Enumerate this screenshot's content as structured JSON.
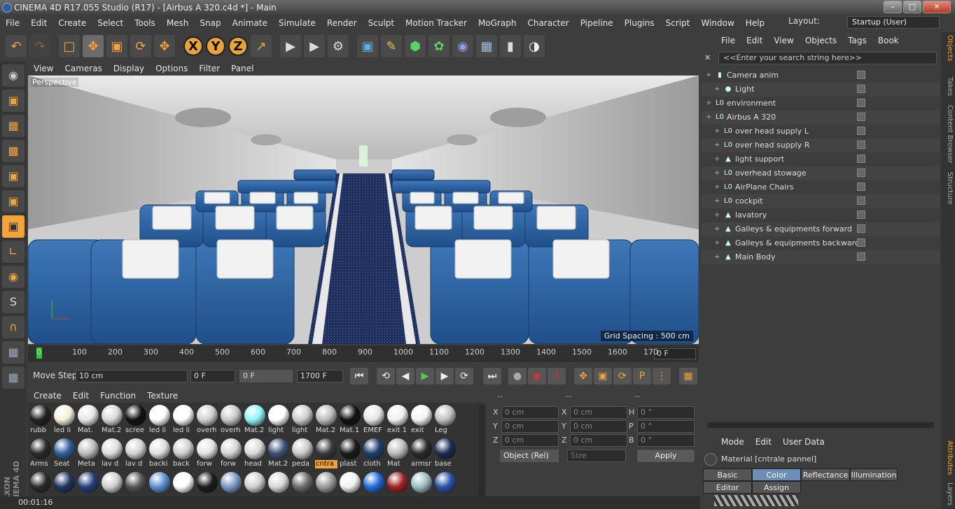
{
  "window": {
    "title": "CINEMA 4D R17.055 Studio (R17) - [Airbus A 320.c4d *] - Main"
  },
  "menubar": [
    "File",
    "Edit",
    "Create",
    "Select",
    "Tools",
    "Mesh",
    "Snap",
    "Animate",
    "Simulate",
    "Render",
    "Sculpt",
    "Motion Tracker",
    "MoGraph",
    "Character",
    "Pipeline",
    "Plugins",
    "Script",
    "Window",
    "Help"
  ],
  "layout": {
    "label": "Layout:",
    "value": "Startup (User)"
  },
  "viewport": {
    "menu": [
      "View",
      "Cameras",
      "Display",
      "Options",
      "Filter",
      "Panel"
    ],
    "label": "Perspective",
    "grid_spacing": "Grid Spacing : 500 cm"
  },
  "timeline": {
    "ticks": [
      "0",
      "100",
      "200",
      "300",
      "400",
      "500",
      "600",
      "700",
      "800",
      "900",
      "1000",
      "1100",
      "1200",
      "1300",
      "1400",
      "1500",
      "1600",
      "170"
    ],
    "frame": "0 F"
  },
  "controls": {
    "move_step_label": "Move Step",
    "move_step_value": "10 cm",
    "start_frame": "0 F",
    "current_frame": "0 F",
    "end_frame": "1700 F"
  },
  "materials": {
    "menu": [
      "Create",
      "Edit",
      "Function",
      "Texture"
    ],
    "row1": [
      {
        "name": "rubb",
        "color": "#222"
      },
      {
        "name": "led li",
        "color": "#f5efd8"
      },
      {
        "name": "Mat.",
        "color": "#e6e6e6"
      },
      {
        "name": "Mat.2",
        "color": "#d8d8d8"
      },
      {
        "name": "scree",
        "color": "#111"
      },
      {
        "name": "led li",
        "color": "#ffffff"
      },
      {
        "name": "led li",
        "color": "#ffffff"
      },
      {
        "name": "overh",
        "color": "#cfcfcf"
      },
      {
        "name": "overh",
        "color": "#c8c8c8"
      },
      {
        "name": "Mat.2",
        "color": "#8ff3f5"
      },
      {
        "name": "light",
        "color": "#ffffff"
      },
      {
        "name": "light",
        "color": "#cccccc"
      },
      {
        "name": "Mat.2",
        "color": "#bbbbbb"
      },
      {
        "name": "Mat.1",
        "color": "#111"
      },
      {
        "name": "EMEF",
        "color": "#e6e6e6"
      },
      {
        "name": "exit 1",
        "color": "#f0f0f0"
      },
      {
        "name": "exit",
        "color": "#f4f4f4"
      },
      {
        "name": "Leg",
        "color": "#c0c0c0"
      }
    ],
    "row2": [
      {
        "name": "Arms",
        "color": "#2a2a2a"
      },
      {
        "name": "Seat",
        "color": "#2f5f9a"
      },
      {
        "name": "Meta",
        "color": "#bdbdbd"
      },
      {
        "name": "lav d",
        "color": "#dcdcdc"
      },
      {
        "name": "lav d",
        "color": "#d4d4d4"
      },
      {
        "name": "backi",
        "color": "#e0e0e0"
      },
      {
        "name": "back",
        "color": "#cfcfcf"
      },
      {
        "name": "forw",
        "color": "#e3e3e3"
      },
      {
        "name": "forw",
        "color": "#d6d6d6"
      },
      {
        "name": "head",
        "color": "#d9d9d9"
      },
      {
        "name": "Mat.2",
        "color": "#3b5275"
      },
      {
        "name": "peda",
        "color": "#c9c9c9"
      },
      {
        "name": "cntra",
        "color": "#3a3a3a"
      },
      {
        "name": "plast",
        "color": "#1a1a1a"
      },
      {
        "name": "cloth",
        "color": "#1e3f70"
      },
      {
        "name": "Mat",
        "color": "#bcbcbc"
      },
      {
        "name": "armsr",
        "color": "#2a2a2a"
      },
      {
        "name": "base",
        "color": "#1a2d55"
      }
    ],
    "row3": [
      {
        "name": "",
        "color": "#2a2a2a"
      },
      {
        "name": "",
        "color": "#1e3460"
      },
      {
        "name": "",
        "color": "#23407a"
      },
      {
        "name": "",
        "color": "#d0d0d0"
      },
      {
        "name": "",
        "color": "#555"
      },
      {
        "name": "",
        "color": "#5b8fd0"
      },
      {
        "name": "",
        "color": "#ffffff"
      },
      {
        "name": "",
        "color": "#1a1a1a"
      },
      {
        "name": "",
        "color": "#7a99c2"
      },
      {
        "name": "",
        "color": "#cfcfcf"
      },
      {
        "name": "",
        "color": "#d8d8d8"
      },
      {
        "name": "",
        "color": "#6b6b6b"
      },
      {
        "name": "",
        "color": "#9a9a9a"
      },
      {
        "name": "",
        "color": "#f2f2f2"
      },
      {
        "name": "",
        "color": "#1d6ad8"
      },
      {
        "name": "",
        "color": "#a12222"
      },
      {
        "name": "",
        "color": "#9bbcc0"
      },
      {
        "name": "",
        "color": "#2a52a8"
      }
    ],
    "selected": "cntra"
  },
  "coords": {
    "headers": [
      "--",
      "--",
      "--"
    ],
    "rows": [
      {
        "a": "X",
        "av": "0 cm",
        "b": "X",
        "bv": "0 cm",
        "c": "H",
        "cv": "0 °"
      },
      {
        "a": "Y",
        "av": "0 cm",
        "b": "Y",
        "bv": "0 cm",
        "c": "P",
        "cv": "0 °"
      },
      {
        "a": "Z",
        "av": "0 cm",
        "b": "Z",
        "bv": "0 cm",
        "c": "B",
        "cv": "0 °"
      }
    ],
    "mode": "Object (Rel)",
    "size": "Size",
    "apply": "Apply"
  },
  "objects": {
    "menu": [
      "File",
      "Edit",
      "View",
      "Objects",
      "Tags",
      "Book"
    ],
    "search_placeholder": "<<Enter your search string here>>",
    "items": [
      {
        "name": "Camera anim",
        "indent": 0,
        "icon": "camera-icon"
      },
      {
        "name": "Light",
        "indent": 1,
        "icon": "light-icon"
      },
      {
        "name": "environment",
        "indent": 0,
        "icon": "null-icon"
      },
      {
        "name": "Airbus A 320",
        "indent": 0,
        "icon": "null-icon"
      },
      {
        "name": "over head supply L",
        "indent": 1,
        "icon": "null-icon"
      },
      {
        "name": "over head supply R",
        "indent": 1,
        "icon": "null-icon"
      },
      {
        "name": "light support",
        "indent": 1,
        "icon": "poly-icon"
      },
      {
        "name": "overhead stowage",
        "indent": 1,
        "icon": "null-icon"
      },
      {
        "name": "AirPlane Chairs",
        "indent": 1,
        "icon": "null-icon"
      },
      {
        "name": "cockpit",
        "indent": 1,
        "icon": "null-icon"
      },
      {
        "name": "lavatory",
        "indent": 1,
        "icon": "poly-icon"
      },
      {
        "name": "Galleys & equipments forward",
        "indent": 1,
        "icon": "poly-icon"
      },
      {
        "name": "Galleys & equipments backward",
        "indent": 1,
        "icon": "poly-icon"
      },
      {
        "name": "Main Body",
        "indent": 1,
        "icon": "poly-icon"
      }
    ]
  },
  "attributes": {
    "menu": [
      "Mode",
      "Edit",
      "User Data"
    ],
    "material_title": "Material [cntrale pannel]",
    "tabs": [
      "Basic",
      "Color",
      "Reflectance",
      "Illumination",
      "Editor",
      "Assign"
    ],
    "active_tab": "Color"
  },
  "right_tabs": [
    "Objects",
    "Takes",
    "Content Browser",
    "Structure",
    "Attributes",
    "Layers"
  ],
  "status": {
    "time": "00:01:16"
  }
}
